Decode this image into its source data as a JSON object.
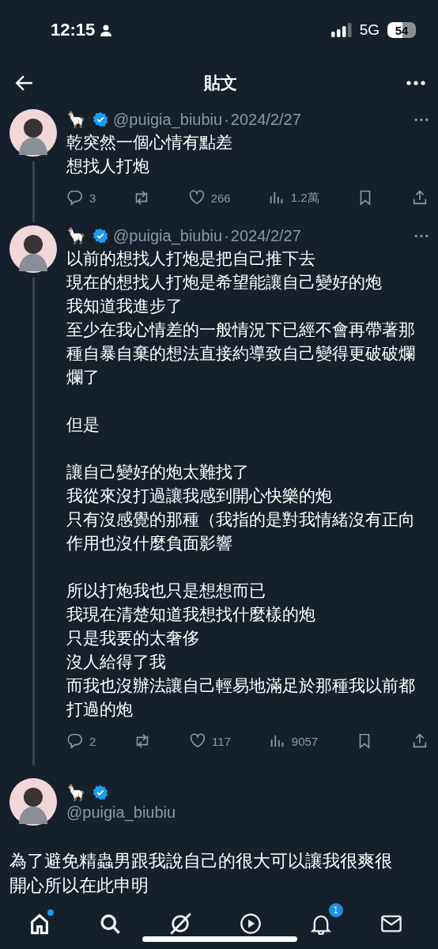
{
  "status_bar": {
    "time": "12:15",
    "network": "5G",
    "battery": "54"
  },
  "header": {
    "title": "貼文"
  },
  "tweets": [
    {
      "display_name": "🦙",
      "verified": true,
      "handle": "@puigia_biubiu",
      "separator": "·",
      "date": "2024/2/27",
      "thread_line": true,
      "paragraphs": [
        [
          "乾突然一個心情有點差",
          "想找人打炮"
        ]
      ],
      "stats": {
        "replies": "3",
        "likes": "266",
        "views": "1.2萬"
      }
    },
    {
      "display_name": "🦙",
      "verified": true,
      "handle": "@puigia_biubiu",
      "separator": "·",
      "date": "2024/2/27",
      "thread_line": true,
      "paragraphs": [
        [
          "以前的想找人打炮是把自己推下去",
          "現在的想找人打炮是希望能讓自己變好的炮",
          "我知道我進步了",
          "至少在我心情差的一般情況下已經不會再帶著那",
          "種自暴自棄的想法直接約導致自己變得更破破爛",
          "爛了"
        ],
        [
          "但是"
        ],
        [
          "讓自己變好的炮太難找了",
          "我從來沒打過讓我感到開心快樂的炮",
          "只有沒感覺的那種（我指的是對我情緒沒有正向",
          "作用也沒什麼負面影響"
        ],
        [
          "所以打炮我也只是想想而已",
          "我現在清楚知道我想找什麼樣的炮",
          "只是我要的太奢侈",
          "沒人給得了我",
          "而我也沒辦法讓自己輕易地滿足於那種我以前都",
          "打過的炮"
        ]
      ],
      "stats": {
        "replies": "2",
        "likes": "117",
        "views": "9057"
      }
    }
  ],
  "main_tweet": {
    "display_name": "🦙",
    "verified": true,
    "handle": "@puigia_biubiu",
    "paragraphs": [
      [
        "為了避免精蟲男跟我說自己的很大可以讓我很爽很",
        "開心所以在此申明"
      ]
    ]
  },
  "tab_bar": [
    {
      "kind": "home",
      "selected": true,
      "dot": true
    },
    {
      "kind": "search",
      "selected": false
    },
    {
      "kind": "grok",
      "selected": false
    },
    {
      "kind": "video",
      "selected": false
    },
    {
      "kind": "bell",
      "selected": false,
      "badge": "1"
    },
    {
      "kind": "mail",
      "selected": false
    }
  ]
}
